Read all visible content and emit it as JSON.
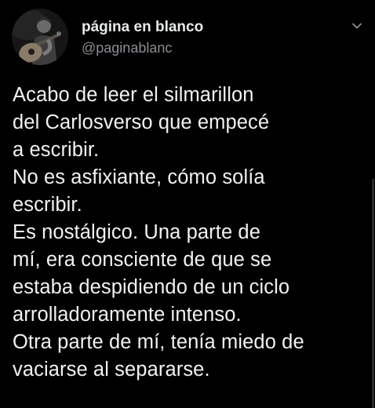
{
  "author": {
    "display_name": "página en blanco",
    "handle": "@paginablanc",
    "avatar_icon": "guitarist-photo-avatar"
  },
  "menu": {
    "icon": "chevron-down-icon"
  },
  "tweet": {
    "lines": [
      "Acabo de leer el silmarillon",
      "del Carlosverso que empecé",
      "a escribir.",
      "No es asfixiante, cómo solía",
      "escribir.",
      "Es nostálgico. Una parte de",
      "mí, era consciente de que se",
      "estaba despidiendo de un ciclo",
      "arrolladoramente intenso.",
      "Otra parte de mí, tenía miedo de",
      "vaciarse al separarse."
    ]
  },
  "colors": {
    "background": "#000000",
    "text_primary": "#e7e9ea",
    "text_secondary": "#8b8f93"
  }
}
